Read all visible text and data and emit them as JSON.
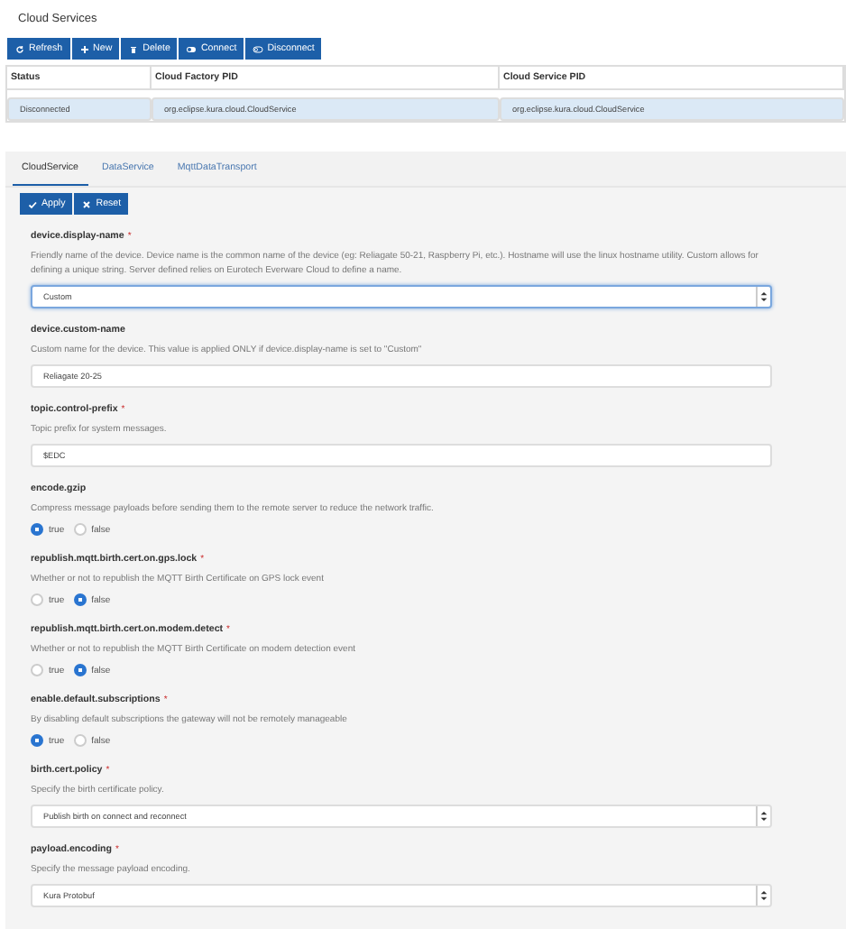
{
  "page_title": "Cloud Services",
  "toolbar": [
    "Refresh",
    "New",
    "Delete",
    "Connect",
    "Disconnect"
  ],
  "table": {
    "columns": [
      "Status",
      "Cloud Factory PID",
      "Cloud Service PID"
    ],
    "rows": [
      {
        "selected": true,
        "cells": [
          "Disconnected",
          "org.eclipse.kura.cloud.CloudService",
          "org.eclipse.kura.cloud.CloudService"
        ]
      }
    ]
  },
  "tabs": [
    {
      "label": "CloudService",
      "selected": true
    },
    {
      "label": "DataService",
      "selected": false
    },
    {
      "label": "MqttDataTransport",
      "selected": false
    }
  ],
  "form_buttons": [
    "Apply",
    "Reset"
  ],
  "fields": [
    {
      "kind": "select",
      "name": "device.display-name",
      "required_mark": "*",
      "description": "Friendly name of the device. Device name is the common name of the device (eg: Reliagate 50-21, Raspberry Pi, etc.). Hostname will use the linux hostname utility. Custom allows for defining a unique string. Server defined relies on Eurotech Everware Cloud to define a name.",
      "value": "Custom",
      "focused": true
    },
    {
      "kind": "text",
      "name": "device.custom-name",
      "description": "Custom name for the device. This value is applied ONLY if device.display-name is set to \"Custom\"",
      "value": "Reliagate 20-25"
    },
    {
      "kind": "text",
      "name": "topic.control-prefix",
      "required_mark": "*",
      "description": "Topic prefix for system messages.",
      "value": "$EDC"
    },
    {
      "kind": "radio",
      "name": "encode.gzip",
      "description": "Compress message payloads before sending them to the remote server to reduce the network traffic.",
      "options": [
        {
          "label": "true",
          "selected": true
        },
        {
          "label": "false",
          "selected": false
        }
      ]
    },
    {
      "kind": "radio",
      "name": "republish.mqtt.birth.cert.on.gps.lock",
      "required_mark": "*",
      "description": "Whether or not to republish the MQTT Birth Certificate on GPS lock event",
      "options": [
        {
          "label": "true",
          "selected": false
        },
        {
          "label": "false",
          "selected": true
        }
      ]
    },
    {
      "kind": "radio",
      "name": "republish.mqtt.birth.cert.on.modem.detect",
      "required_mark": "*",
      "description": "Whether or not to republish the MQTT Birth Certificate on modem detection event",
      "options": [
        {
          "label": "true",
          "selected": false
        },
        {
          "label": "false",
          "selected": true
        }
      ]
    },
    {
      "kind": "radio",
      "name": "enable.default.subscriptions",
      "required_mark": "*",
      "description": "By disabling default subscriptions the gateway will not be remotely manageable",
      "options": [
        {
          "label": "true",
          "selected": true
        },
        {
          "label": "false",
          "selected": false
        }
      ]
    },
    {
      "kind": "select",
      "name": "birth.cert.policy",
      "required_mark": "*",
      "description": "Specify the birth certificate policy.",
      "value": "Publish birth on connect and reconnect",
      "focused": false
    },
    {
      "kind": "select",
      "name": "payload.encoding",
      "required_mark": "*",
      "description": "Specify the message payload encoding.",
      "value": "Kura Protobuf",
      "focused": false
    }
  ]
}
